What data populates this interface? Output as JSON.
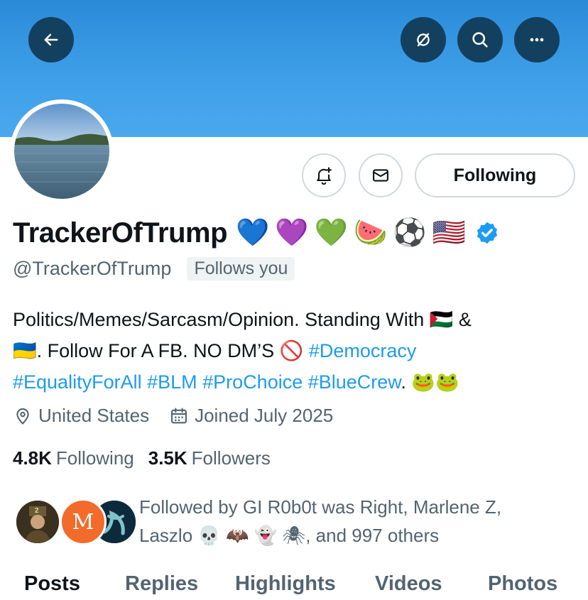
{
  "header": {
    "back_icon": "arrow-left-icon",
    "right_icons": [
      "notifications-off-icon",
      "search-icon",
      "more-icon"
    ]
  },
  "profile": {
    "display_name": "TrackerOfTrump",
    "name_emojis": [
      "💙",
      "💜",
      "💚",
      "🍉",
      "⚽",
      "🇺🇸"
    ],
    "verified": true,
    "handle": "@TrackerOfTrump",
    "follows_you": "Follows you",
    "following_button": "Following",
    "bio": {
      "line1_text": "Politics/Memes/Sarcasm/Opinion. Standing With ",
      "line1_flag": "🇵🇸",
      "line1_amp": " &",
      "line2_flag": "🇺🇦",
      "line2_text": ". Follow For A FB. NO DM’S ",
      "line2_no": "🚫",
      "line2_tag": "#Democracy",
      "line3_tags": [
        "#EqualityForAll",
        "#BLM",
        "#ProChoice",
        "#BlueCrew"
      ],
      "line3_end": ".",
      "line3_emojis": "🐸🐸"
    },
    "location": "United States",
    "joined": "Joined July 2025",
    "following_count": "4.8K",
    "following_label": "Following",
    "followers_count": "3.5K",
    "followers_label": "Followers",
    "followed_by_line1": "Followed by GI R0b0t was Right, Marlene Z,",
    "followed_by_line2_name": "Laszlo ",
    "followed_by_line2_emojis": "💀 🦇 👻 🕷",
    "followed_by_line2_end": ", and 997 others",
    "mini_avatar_letter": "M",
    "mini_avatar_badge": "2"
  },
  "tabs": [
    "Posts",
    "Replies",
    "Highlights",
    "Videos",
    "Photos"
  ],
  "colors": {
    "accent": "#1d9bf0",
    "banner": "#3e9fe8",
    "header_button": "#14405f",
    "muted_text": "#536471"
  }
}
